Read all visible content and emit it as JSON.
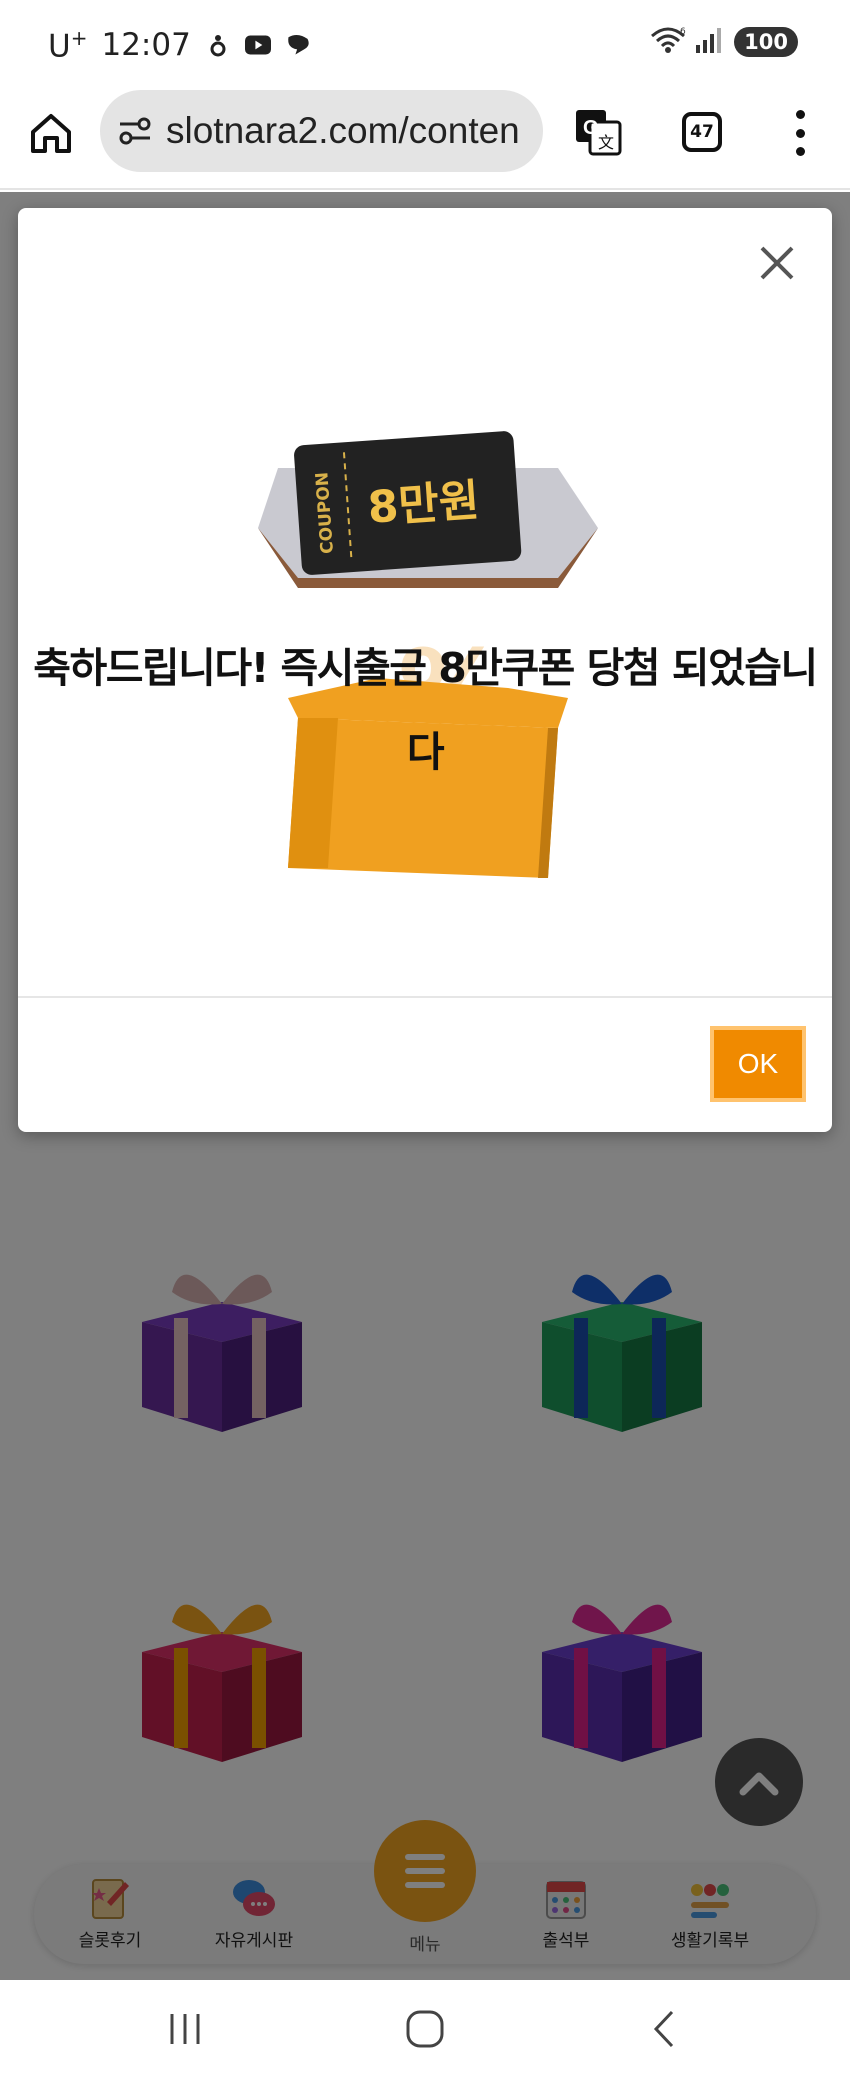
{
  "status_bar": {
    "carrier": "U",
    "carrier_sup": "+",
    "time": "12:07",
    "wifi_label": "6",
    "battery": "100"
  },
  "browser": {
    "url": "slotnara2.com/conten",
    "tab_count": "47"
  },
  "modal": {
    "message": "축하드립니다! 즉시출금 8만쿠폰 당첨 되었습니다",
    "coupon_label": "COUPON",
    "coupon_amount": "8만원",
    "ok_label": "OK"
  },
  "dock": {
    "items": [
      {
        "label": "슬롯후기",
        "icon": "slot-review-icon"
      },
      {
        "label": "자유게시판",
        "icon": "free-board-icon"
      },
      {
        "label": "출석부",
        "icon": "attendance-icon"
      },
      {
        "label": "생활기록부",
        "icon": "life-record-icon"
      }
    ],
    "menu_label": "메뉴"
  },
  "colors": {
    "accent": "#f08a00",
    "fab": "#f5a623",
    "gift_purple": "#6a2fa0",
    "gift_green": "#1f9c5a",
    "gift_red": "#c4204f",
    "gift_violet": "#5b2fb0"
  }
}
